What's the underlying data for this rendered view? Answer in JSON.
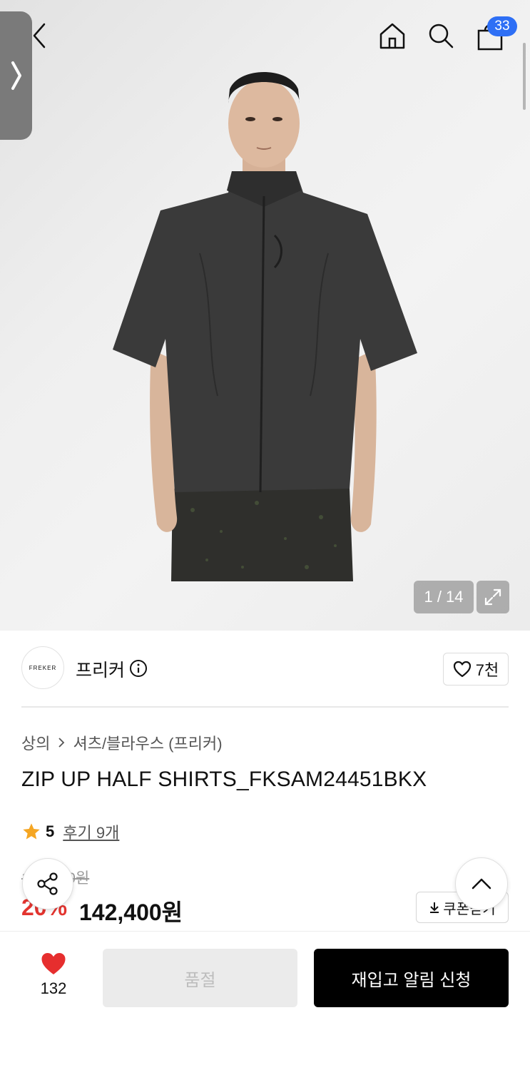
{
  "gallery": {
    "counter": "1 / 14"
  },
  "header": {
    "cart_count": "33"
  },
  "brand": {
    "name": "프리커",
    "logo_text": "FREKER",
    "likes": "7천"
  },
  "breadcrumb": {
    "category": "상의",
    "subcategory": "셔츠/블라우스 (프리커)"
  },
  "product": {
    "title": "ZIP UP HALF SHIRTS_FKSAM24451BKX",
    "rating": "5",
    "reviews": "후기 9개",
    "original_price": "178,000원",
    "discount": "20%",
    "price": "142,400원",
    "coupon_label": "쿠폰받기"
  },
  "bottom_bar": {
    "wish_count": "132",
    "soldout_label": "품절",
    "restock_label": "재입고 알림 신청"
  },
  "icons": {
    "back": "chevron-left-icon",
    "home": "home-icon",
    "search": "search-icon",
    "cart": "shopping-bag-icon",
    "expand": "expand-icon",
    "info": "info-icon",
    "heart": "heart-icon",
    "star": "star-icon",
    "share": "share-icon",
    "top": "chevron-up-icon",
    "download": "download-icon"
  },
  "colors": {
    "accent_blue": "#2e6ff5",
    "discount_red": "#e3342f",
    "wish_red": "#e62e2e",
    "star_orange": "#f5a623",
    "primary_button": "#000000"
  }
}
